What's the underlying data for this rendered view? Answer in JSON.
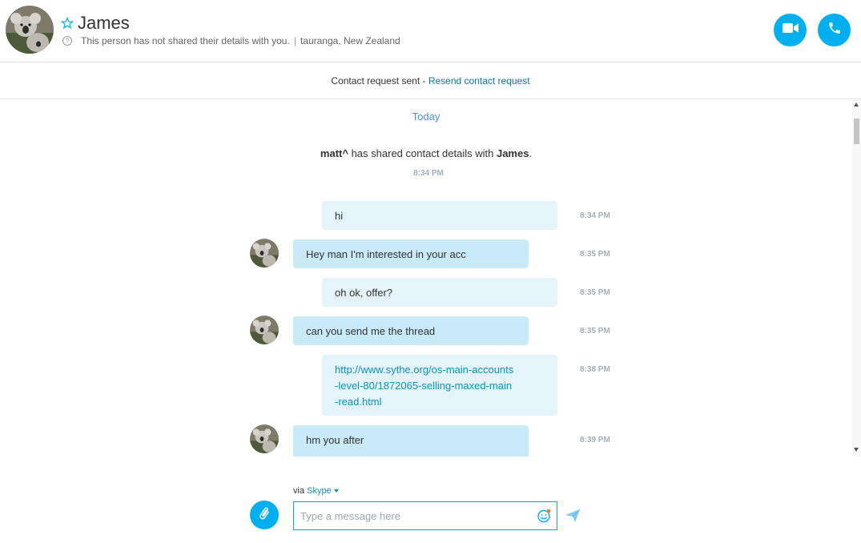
{
  "header": {
    "contact_name": "James",
    "details_text": "This person has not shared their details with you.",
    "location": "tauranga, New Zealand",
    "separator": "|"
  },
  "request_bar": {
    "status": "Contact request sent - ",
    "resend_link": "Resend contact request"
  },
  "conversation": {
    "day_label": "Today",
    "system": {
      "from": "matt^",
      "text": " has shared contact details with ",
      "to": "James",
      "end": ".",
      "time": "8:34 PM"
    },
    "messages": [
      {
        "direction": "out",
        "text": "hi",
        "time": "8:34 PM"
      },
      {
        "direction": "in",
        "text": "Hey man I'm interested in your acc",
        "time": "8:35 PM"
      },
      {
        "direction": "out",
        "text": "oh ok, offer?",
        "time": "8:35 PM"
      },
      {
        "direction": "in",
        "text": "can you send me the thread",
        "time": "8:35 PM"
      },
      {
        "direction": "out",
        "link_lines": [
          "http://www.sythe.org/os-main-accounts",
          "-level-80/1872065-selling-maxed-main",
          "-read.html"
        ],
        "time": "8:38 PM"
      },
      {
        "direction": "in",
        "text": "hm you after",
        "time": "8:39 PM"
      }
    ]
  },
  "composer": {
    "via_label": "via",
    "service": "Skype",
    "placeholder": "Type a message here"
  },
  "colors": {
    "accent": "#00aff0",
    "link": "#0f8fc4",
    "bubble_in": "#c9eaf9",
    "bubble_out": "#e5f4fb",
    "timestamp": "#9fb0bd"
  },
  "icons": {
    "favorite": "star-icon",
    "info": "info-icon",
    "video_call": "video-camera-icon",
    "audio_call": "phone-icon",
    "attach": "paperclip-icon",
    "emoji": "emoji-icon",
    "send": "send-icon"
  }
}
